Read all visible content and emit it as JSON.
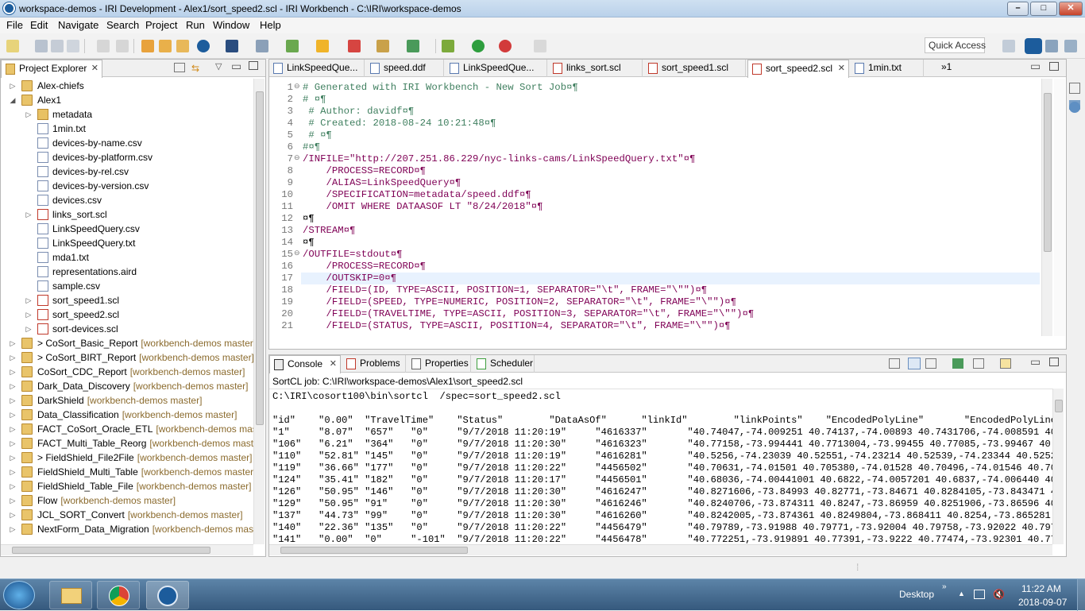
{
  "window": {
    "title": "workspace-demos - IRI Development - Alex1/sort_speed2.scl - IRI Workbench - C:\\IRI\\workspace-demos",
    "min_label": "–",
    "max_label": "□",
    "close_label": "✕"
  },
  "menu": [
    "File",
    "Edit",
    "Navigate",
    "Search",
    "Project",
    "Run",
    "Window",
    "Help"
  ],
  "quick_access": {
    "placeholder": "Quick Access"
  },
  "project_explorer": {
    "title": "Project Explorer",
    "items": [
      {
        "label": "Alex-chiefs",
        "git": "",
        "arrow": "▷"
      },
      {
        "label": "Alex1",
        "git": "",
        "arrow": "◢"
      },
      {
        "label": "metadata",
        "git": "",
        "arrow": "▷"
      },
      {
        "label": "1min.txt",
        "git": "",
        "arrow": ""
      },
      {
        "label": "devices-by-name.csv",
        "git": "",
        "arrow": ""
      },
      {
        "label": "devices-by-platform.csv",
        "git": "",
        "arrow": ""
      },
      {
        "label": "devices-by-rel.csv",
        "git": "",
        "arrow": ""
      },
      {
        "label": "devices-by-version.csv",
        "git": "",
        "arrow": ""
      },
      {
        "label": "devices.csv",
        "git": "",
        "arrow": ""
      },
      {
        "label": "links_sort.scl",
        "git": "",
        "arrow": "▷"
      },
      {
        "label": "LinkSpeedQuery.csv",
        "git": "",
        "arrow": ""
      },
      {
        "label": "LinkSpeedQuery.txt",
        "git": "",
        "arrow": ""
      },
      {
        "label": "mda1.txt",
        "git": "",
        "arrow": ""
      },
      {
        "label": "representations.aird",
        "git": "",
        "arrow": ""
      },
      {
        "label": "sample.csv",
        "git": "",
        "arrow": ""
      },
      {
        "label": "sort_speed1.scl",
        "git": "",
        "arrow": "▷"
      },
      {
        "label": "sort_speed2.scl",
        "git": "",
        "arrow": "▷"
      },
      {
        "label": "sort-devices.scl",
        "git": "",
        "arrow": "▷"
      },
      {
        "label": "> CoSort_Basic_Report",
        "git": "[workbench-demos master]",
        "arrow": "▷"
      },
      {
        "label": "> CoSort_BIRT_Report",
        "git": "[workbench-demos master]",
        "arrow": "▷"
      },
      {
        "label": "CoSort_CDC_Report",
        "git": "[workbench-demos master]",
        "arrow": "▷"
      },
      {
        "label": "Dark_Data_Discovery",
        "git": "[workbench-demos master]",
        "arrow": "▷"
      },
      {
        "label": "DarkShield",
        "git": "[workbench-demos master]",
        "arrow": "▷"
      },
      {
        "label": "Data_Classification",
        "git": "[workbench-demos master]",
        "arrow": "▷"
      },
      {
        "label": "FACT_CoSort_Oracle_ETL",
        "git": "[workbench-demos mast",
        "arrow": "▷"
      },
      {
        "label": "FACT_Multi_Table_Reorg",
        "git": "[workbench-demos mast",
        "arrow": "▷"
      },
      {
        "label": "> FieldShield_File2File",
        "git": "[workbench-demos master]",
        "arrow": "▷"
      },
      {
        "label": "FieldShield_Multi_Table",
        "git": "[workbench-demos master",
        "arrow": "▷"
      },
      {
        "label": "FieldShield_Table_File",
        "git": "[workbench-demos master]",
        "arrow": "▷"
      },
      {
        "label": "Flow",
        "git": "[workbench-demos master]",
        "arrow": "▷"
      },
      {
        "label": "JCL_SORT_Convert",
        "git": "[workbench-demos master]",
        "arrow": "▷"
      },
      {
        "label": "NextForm_Data_Migration",
        "git": "[workbench-demos mas",
        "arrow": "▷"
      }
    ]
  },
  "editor": {
    "tabs": [
      {
        "label": "LinkSpeedQue...",
        "kind": "file"
      },
      {
        "label": "speed.ddf",
        "kind": "file"
      },
      {
        "label": "LinkSpeedQue...",
        "kind": "file"
      },
      {
        "label": "links_sort.scl",
        "kind": "scl"
      },
      {
        "label": "sort_speed1.scl",
        "kind": "scl"
      },
      {
        "label": "sort_speed2.scl",
        "kind": "scl"
      },
      {
        "label": "1min.txt",
        "kind": "file"
      }
    ],
    "overflow_label": "»1",
    "lines": [
      {
        "n": "1",
        "t": "# Generated with IRI Workbench - New Sort Job¤¶"
      },
      {
        "n": "2",
        "t": "# ¤¶"
      },
      {
        "n": "3",
        "t": " # Author: davidf¤¶"
      },
      {
        "n": "4",
        "t": " # Created: 2018-08-24 10:21:48¤¶"
      },
      {
        "n": "5",
        "t": " # ¤¶"
      },
      {
        "n": "6",
        "t": "#¤¶"
      },
      {
        "n": "7",
        "t": "/INFILE=\"http://207.251.86.229/nyc-links-cams/LinkSpeedQuery.txt\"¤¶"
      },
      {
        "n": "8",
        "t": "    /PROCESS=RECORD¤¶"
      },
      {
        "n": "9",
        "t": "    /ALIAS=LinkSpeedQuery¤¶"
      },
      {
        "n": "10",
        "t": "    /SPECIFICATION=metadata/speed.ddf¤¶"
      },
      {
        "n": "11",
        "t": "    /OMIT WHERE DATAASOF LT \"8/24/2018\"¤¶"
      },
      {
        "n": "12",
        "t": "¤¶"
      },
      {
        "n": "13",
        "t": "/STREAM¤¶"
      },
      {
        "n": "14",
        "t": "¤¶"
      },
      {
        "n": "15",
        "t": "/OUTFILE=stdout¤¶"
      },
      {
        "n": "16",
        "t": "    /PROCESS=RECORD¤¶"
      },
      {
        "n": "17",
        "t": "    /OUTSKIP=0¤¶"
      },
      {
        "n": "18",
        "t": "    /FIELD=(ID, TYPE=ASCII, POSITION=1, SEPARATOR=\"\\t\", FRAME=\"\\\"\")¤¶"
      },
      {
        "n": "19",
        "t": "    /FIELD=(SPEED, TYPE=NUMERIC, POSITION=2, SEPARATOR=\"\\t\", FRAME=\"\\\"\")¤¶"
      },
      {
        "n": "20",
        "t": "    /FIELD=(TRAVELTIME, TYPE=ASCII, POSITION=3, SEPARATOR=\"\\t\", FRAME=\"\\\"\")¤¶"
      },
      {
        "n": "21",
        "t": "    /FIELD=(STATUS, TYPE=ASCII, POSITION=4, SEPARATOR=\"\\t\", FRAME=\"\\\"\")¤¶"
      }
    ]
  },
  "console": {
    "tabs": [
      "Console",
      "Problems",
      "Properties",
      "Scheduler"
    ],
    "job": "SortCL job: C:\\IRI\\workspace-demos\\Alex1\\sort_speed2.scl",
    "command": "C:\\IRI\\cosort100\\bin\\sortcl  /spec=sort_speed2.scl",
    "header": "\"id\"    \"0.00\"  \"TravelTime\"    \"Status\"        \"DataAsOf\"      \"linkId\"        \"linkPoints\"    \"EncodedPolyLine\"       \"EncodedPolyLineLvls\"",
    "rows": [
      "\"1\"     \"8.07\"  \"657\"   \"0\"     \"9/7/2018 11:20:19\"     \"4616337\"       \"40.74047,-74.009251 40.74137,-74.00893 40.7431706,-74.008591 40.746",
      "\"106\"   \"6.21\"  \"364\"   \"0\"     \"9/7/2018 11:20:30\"     \"4616323\"       \"40.77158,-73.994441 40.7713004,-73.99455 40.77085,-73.99467 40.7699",
      "\"110\"   \"52.81\" \"145\"   \"0\"     \"9/7/2018 11:20:19\"     \"4616281\"       \"40.5256,-74.23039 40.52551,-74.23214 40.52539,-74.23344 40.52526,-7",
      "\"119\"   \"36.66\" \"177\"   \"0\"     \"9/7/2018 11:20:22\"     \"4456502\"       \"40.70631,-74.01501 40.705380,-74.01528 40.70496,-74.01546 40.70374,",
      "\"124\"   \"35.41\" \"182\"   \"0\"     \"9/7/2018 11:20:17\"     \"4456501\"       \"40.68036,-74.00441001 40.6822,-74.0057201 40.6837,-74.006440 40.685",
      "\"126\"   \"50.95\" \"146\"   \"0\"     \"9/7/2018 11:20:30\"     \"4616247\"       \"40.8271606,-73.84993 40.82771,-73.84671 40.8284105,-73.843471 40.82",
      "\"129\"   \"50.95\" \"91\"    \"0\"     \"9/7/2018 11:20:30\"     \"4616246\"       \"40.8240706,-73.874311 40.8247,-73.86959 40.8251906,-73.86596 40.825",
      "\"137\"   \"44.73\" \"99\"    \"0\"     \"9/7/2018 11:20:30\"     \"4616260\"       \"40.8242005,-73.874361 40.8249804,-73.868411 40.8254,-73.865281 40.8",
      "\"140\"   \"22.36\" \"135\"   \"0\"     \"9/7/2018 11:20:22\"     \"4456479\"       \"40.79789,-73.91988 40.79771,-73.92004 40.79758,-73.92022 40.7974704",
      "\"141\"   \"0.00\"  \"0\"     \"-101\"  \"9/7/2018 11:20:22\"     \"4456478\"       \"40.772251,-73.919891 40.77391,-73.9222 40.77474,-73.92301 40.77647,"
    ]
  },
  "taskbar": {
    "desktop_label": "Desktop",
    "time": "11:22 AM",
    "date": "2018-09-07"
  },
  "colors": {
    "accent": "#2b5797",
    "comment": "#3f7f5f",
    "keyword": "#7f0055",
    "string": "#2a00ff"
  }
}
